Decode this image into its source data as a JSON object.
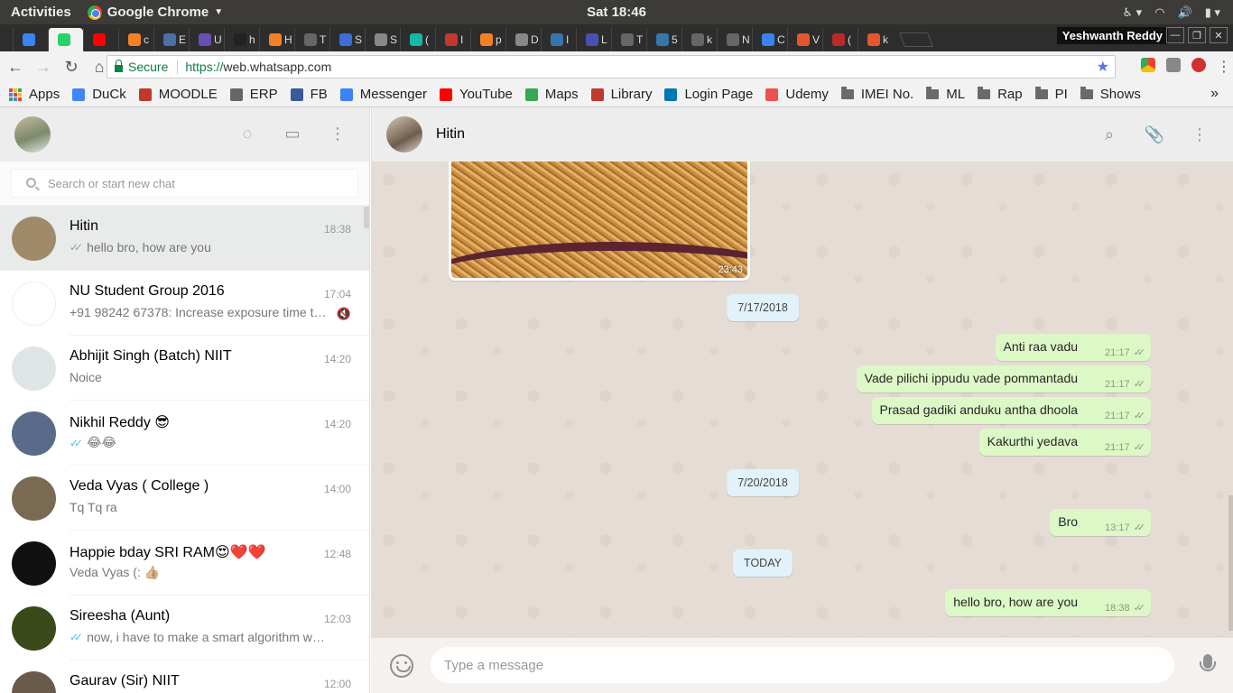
{
  "os_bar": {
    "activities": "Activities",
    "app_name": "Google Chrome",
    "clock": "Sat 18:46"
  },
  "tabs": [
    {
      "title": "",
      "icon": "messenger-icon",
      "color": "#3b82f6"
    },
    {
      "title": "",
      "icon": "whatsapp-icon",
      "color": "#25d366",
      "active": true
    },
    {
      "title": "",
      "icon": "youtube-icon",
      "color": "#ff0000"
    },
    {
      "title": "c",
      "icon": "stackoverflow-icon",
      "color": "#f48024"
    },
    {
      "title": "E",
      "icon": "doc-icon",
      "color": "#4a6fa5"
    },
    {
      "title": "U",
      "icon": "grid-icon",
      "color": "#6a4fb3"
    },
    {
      "title": "h",
      "icon": "github-icon",
      "color": "#222222"
    },
    {
      "title": "H",
      "icon": "stackoverflow-icon",
      "color": "#f48024"
    },
    {
      "title": "T",
      "icon": "book-icon",
      "color": "#666666"
    },
    {
      "title": "S",
      "icon": "p-icon",
      "color": "#3b6fd6"
    },
    {
      "title": "S",
      "icon": "page-icon",
      "color": "#888888"
    },
    {
      "title": "(",
      "icon": "r-icon",
      "color": "#14b8a6"
    },
    {
      "title": "I",
      "icon": "udacity-icon",
      "color": "#c0392b"
    },
    {
      "title": "p",
      "icon": "stackoverflow-icon",
      "color": "#f48024"
    },
    {
      "title": "D",
      "icon": "page-icon",
      "color": "#888888"
    },
    {
      "title": "I",
      "icon": "python-icon",
      "color": "#3776ab"
    },
    {
      "title": "L",
      "icon": "s-icon",
      "color": "#4b4fb3"
    },
    {
      "title": "T",
      "icon": "book-icon",
      "color": "#666666"
    },
    {
      "title": "5",
      "icon": "python-icon",
      "color": "#3776ab"
    },
    {
      "title": "k",
      "icon": "book-icon",
      "color": "#666666"
    },
    {
      "title": "N",
      "icon": "book-icon",
      "color": "#666666"
    },
    {
      "title": "C",
      "icon": "infinity-icon",
      "color": "#3b82f6"
    },
    {
      "title": "V",
      "icon": "ask-icon",
      "color": "#e4572e"
    },
    {
      "title": "(",
      "icon": "quora-icon",
      "color": "#b92b27"
    },
    {
      "title": "k",
      "icon": "ask-icon",
      "color": "#e4572e"
    }
  ],
  "window": {
    "profile_name": "Yeshwanth Reddy"
  },
  "omnibox": {
    "secure_label": "Secure",
    "url_scheme": "https://",
    "url_rest": "web.whatsapp.com"
  },
  "bookmarks": [
    {
      "label": "Apps",
      "icon": "apps-grid-icon"
    },
    {
      "label": "DuCk",
      "icon": "google-icon",
      "color": "#4285f4"
    },
    {
      "label": "MOODLE",
      "icon": "moodle-icon",
      "color": "#c0392b"
    },
    {
      "label": "ERP",
      "icon": "page-icon",
      "color": "#666666"
    },
    {
      "label": "FB",
      "icon": "facebook-icon",
      "color": "#3b5998"
    },
    {
      "label": "Messenger",
      "icon": "messenger-icon",
      "color": "#3b82f6"
    },
    {
      "label": "YouTube",
      "icon": "youtube-icon",
      "color": "#ff0000"
    },
    {
      "label": "Maps",
      "icon": "maps-icon",
      "color": "#34a853"
    },
    {
      "label": "Library",
      "icon": "library-icon",
      "color": "#c0392b"
    },
    {
      "label": "Login Page",
      "icon": "linkedin-icon",
      "color": "#0077b5"
    },
    {
      "label": "Udemy",
      "icon": "udemy-icon",
      "color": "#ec5252"
    },
    {
      "label": "IMEI No.",
      "icon": "folder-icon"
    },
    {
      "label": "ML",
      "icon": "folder-icon"
    },
    {
      "label": "Rap",
      "icon": "folder-icon"
    },
    {
      "label": "PI",
      "icon": "folder-icon"
    },
    {
      "label": "Shows",
      "icon": "folder-icon"
    }
  ],
  "sidebar": {
    "search_placeholder": "Search or start new chat",
    "chats": [
      {
        "name": "Hitin",
        "time": "18:38",
        "preview": "hello bro, how are you",
        "ticks": "grey",
        "selected": true,
        "avatar": "#a08a6a"
      },
      {
        "name": "NU Student Group 2016",
        "time": "17:04",
        "preview": "+91 98242 67378: Increase exposure time to …",
        "muted": true,
        "avatar": "#ffffff"
      },
      {
        "name": "Abhijit Singh (Batch) NIIT",
        "time": "14:20",
        "preview": "Noice",
        "avatar": "#dfe5e7"
      },
      {
        "name": "Nikhil Reddy 😎",
        "time": "14:20",
        "preview": "😂😂",
        "ticks": "blue",
        "avatar": "#5a6b8a"
      },
      {
        "name": "Veda Vyas ( College )",
        "time": "14:00",
        "preview": "Tq Tq ra",
        "avatar": "#7a6a52"
      },
      {
        "name": "Happie bday SRI RAM😍❤️❤️",
        "time": "12:48",
        "preview": "Veda Vyas (: 👍🏼",
        "avatar": "#111111"
      },
      {
        "name": "Sireesha (Aunt)",
        "time": "12:03",
        "preview": "now, i have to make a smart algorithm which…",
        "ticks": "blue",
        "avatar": "#3a4a1a"
      },
      {
        "name": "Gaurav (Sir) NIIT",
        "time": "12:00",
        "preview": "",
        "avatar": "#6a5a4a"
      }
    ]
  },
  "conversation": {
    "contact_name": "Hitin",
    "image_message_time": "23:43",
    "date_chips": [
      "7/17/2018",
      "7/20/2018",
      "TODAY"
    ],
    "messages": [
      {
        "text": "Anti raa vadu",
        "time": "21:17"
      },
      {
        "text": "Vade pilichi ippudu vade pommantadu",
        "time": "21:17"
      },
      {
        "text": "Prasad gadiki anduku antha dhoola",
        "time": "21:17"
      },
      {
        "text": "Kakurthi yedava",
        "time": "21:17"
      },
      {
        "text": "Bro",
        "time": "13:17"
      },
      {
        "text": "hello bro, how are you",
        "time": "18:38"
      }
    ],
    "composer_placeholder": "Type a message"
  },
  "colors": {
    "outgoing_bubble": "#dcf8c6",
    "date_chip": "#e1f2fb",
    "chat_background": "#e5ddd5",
    "header_background": "#ededed"
  }
}
